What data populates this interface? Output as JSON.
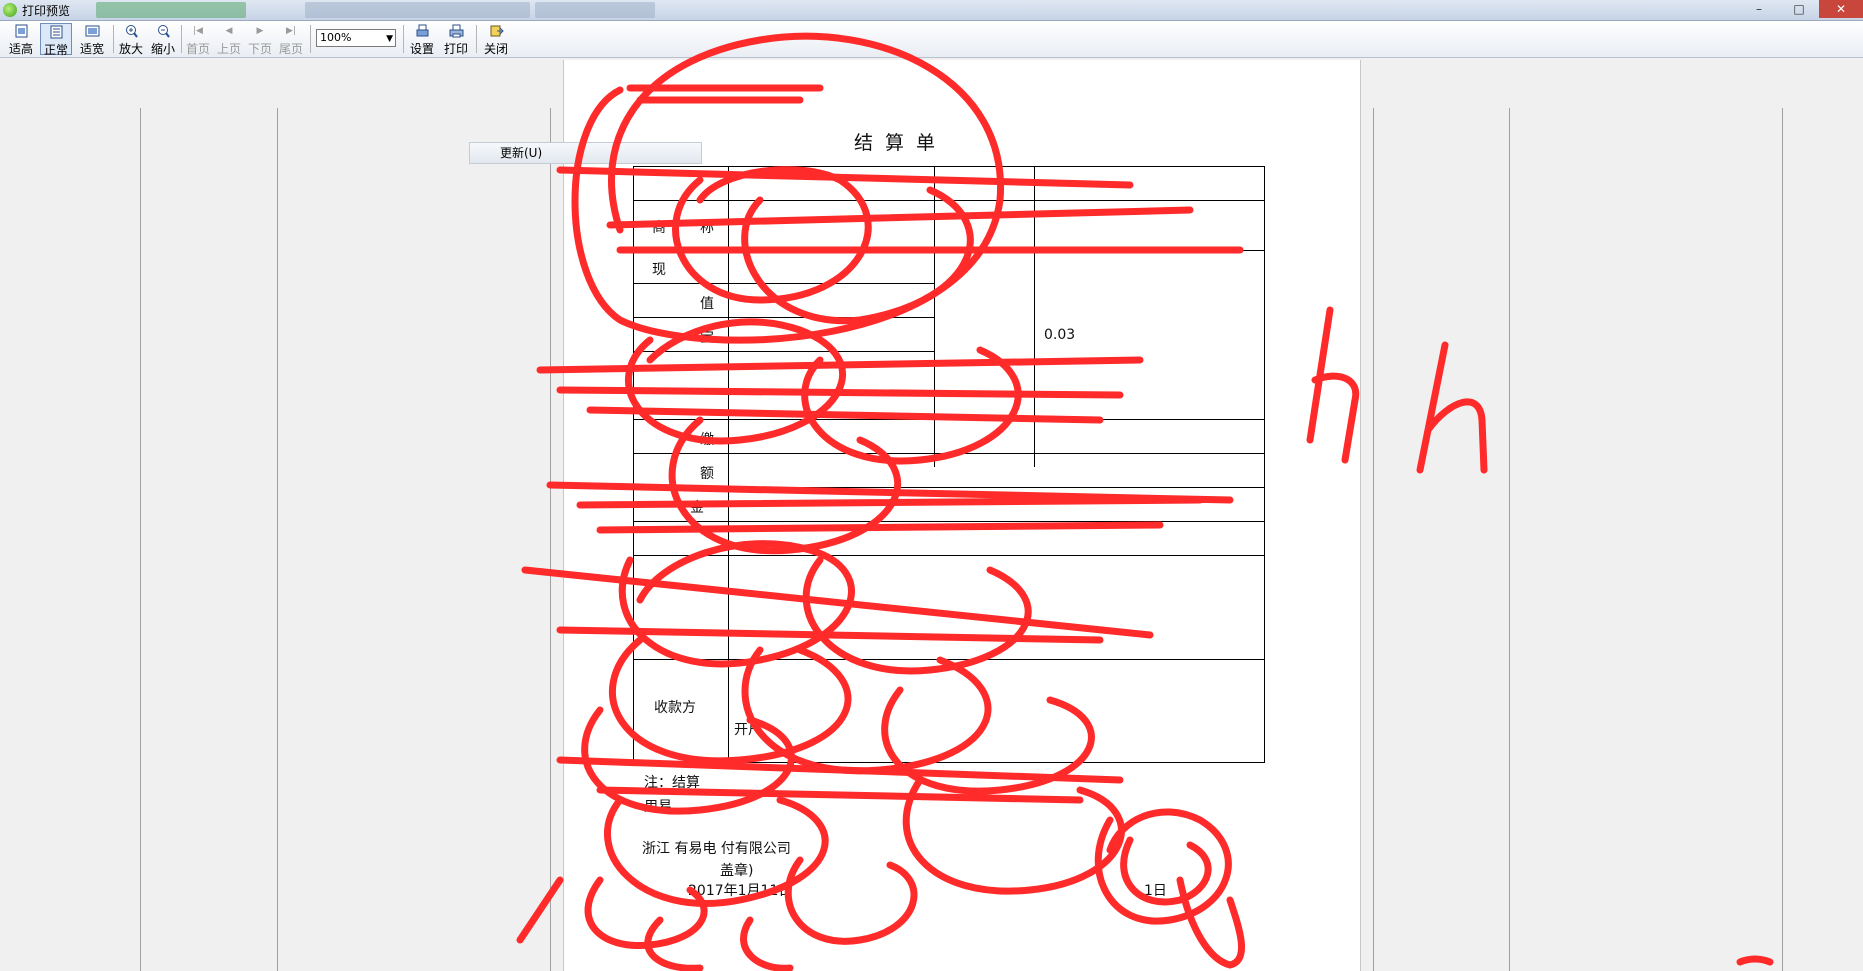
{
  "window": {
    "title": "打印预览"
  },
  "toolbar": {
    "fit_height": "适高",
    "normal": "正常",
    "fit_width": "适宽",
    "zoom_in": "放大",
    "zoom_out": "缩小",
    "first_page": "首页",
    "prev_page": "上页",
    "next_page": "下页",
    "last_page": "尾页",
    "zoom_value": "100%",
    "settings": "设置",
    "print": "打印",
    "close": "关闭"
  },
  "update_button": "更新(U)",
  "document": {
    "title": "结算单",
    "labels": [
      "商",
      "称",
      "现",
      "值",
      "宝",
      "缴",
      "额",
      "金",
      "收款方",
      "开户"
    ],
    "values": [
      "0.03"
    ],
    "note_line1": "注：结算",
    "note_line2": "用易",
    "company": "浙江 有易电 付有限公司",
    "seal": "盖章)",
    "date_left": "2017年1月11日",
    "date_right": "1日"
  },
  "colors": {
    "scribble": "#ff2a2a",
    "toolbar_active": "#dce8f7"
  }
}
